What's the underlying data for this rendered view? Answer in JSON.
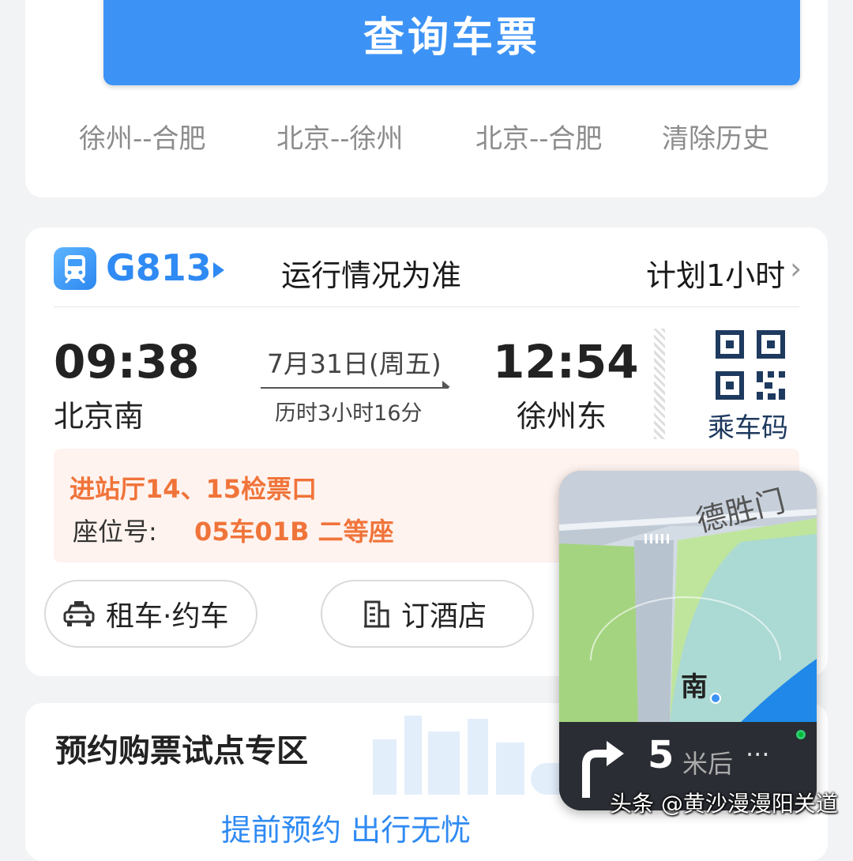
{
  "search": {
    "query_button": "查询车票",
    "history": [
      "徐州--合肥",
      "北京--徐州",
      "北京--合肥"
    ],
    "clear_history": "清除历史"
  },
  "trip": {
    "train_number": "G813",
    "run_note": "运行情况为准",
    "plan_note": "计划1小时",
    "depart_time": "09:38",
    "depart_station": "北京南",
    "date": "7月31日(周五)",
    "duration": "历时3小时16分",
    "arrive_time": "12:54",
    "arrive_station": "徐州东",
    "qr_label": "乘车码",
    "gate": "进站厅14、15检票口",
    "seat_key": "座位号:",
    "seat_value": "05车01B 二等座",
    "notice_extra": "检",
    "actions": {
      "taxi": "租车·约车",
      "hotel": "订酒店"
    },
    "colors": {
      "accent": "#2f8af3",
      "warning": "#f0743a",
      "button": "#3d93f5"
    }
  },
  "promo": {
    "title": "预约购票试点专区",
    "subtitle": "提前预约   出行无忧"
  },
  "nav_overlay": {
    "street": "德胜门",
    "direction": "南",
    "distance": "5",
    "unit": "米后",
    "more": "···"
  },
  "watermark": "头条 @黄沙漫漫阳关道"
}
